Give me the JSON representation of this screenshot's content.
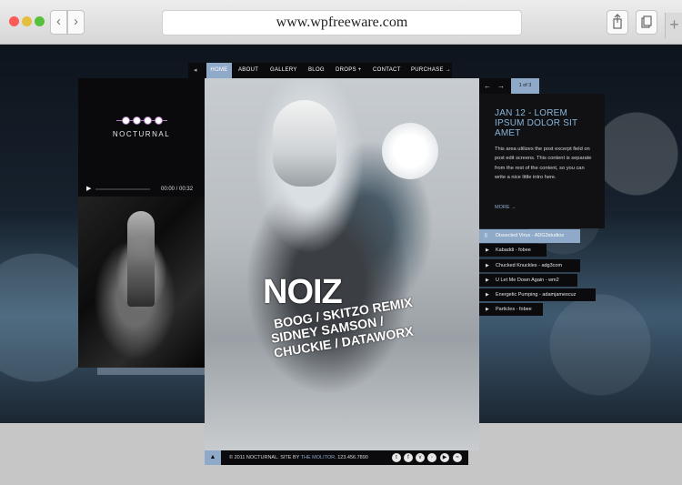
{
  "browser": {
    "url": "www.wpfreeware.com",
    "back_icon": "‹",
    "forward_icon": "›",
    "new_tab_icon": "+"
  },
  "nav": {
    "items": [
      {
        "label": "HOME"
      },
      {
        "label": "ABOUT"
      },
      {
        "label": "GALLERY"
      },
      {
        "label": "BLOG"
      },
      {
        "label": "DROPS +"
      },
      {
        "label": "CONTACT"
      },
      {
        "label": "PURCHASE →"
      }
    ]
  },
  "sidebar": {
    "logo_text": "NOCTURNAL",
    "player": {
      "time": "00:00 / 00:32",
      "progress": 0
    }
  },
  "poster": {
    "title": "NOIZ",
    "lines": [
      "BOOG / SKITZO REMIX",
      "SIDNEY SAMSON /",
      "CHUCKIE / DATAWORX"
    ]
  },
  "footer": {
    "text_before": "© 2011 NOCTURNAL. SITE BY ",
    "link": "THE MOLITOR",
    "text_after": ". 123.456.7890",
    "social_icons": [
      "t",
      "f",
      "v",
      "◦",
      "▶",
      "≈"
    ]
  },
  "post": {
    "prev_arrow": "←",
    "next_arrow": "→",
    "counter": "1 of 3",
    "title": "JAN 12 - LOREM IPSUM DOLOR SIT AMET",
    "body": "This area utilizes the post excerpt field on post edit screens. This content is separate from the rest of the content, so you can write a nice little intro here.",
    "more": "MORE →"
  },
  "playlist": {
    "header": "Dissected Virus - ADG3studios",
    "items": [
      {
        "label": "Kabaddi - fobee"
      },
      {
        "label": "Chucked Knuckles - adg3com"
      },
      {
        "label": "U Let Me Down Again - wm2"
      },
      {
        "label": "Energetic Pumping - adamjamescuz"
      },
      {
        "label": "Particles - fobee"
      }
    ]
  },
  "colors": {
    "accent": "#8fa9c9",
    "post_title": "#89b4d8",
    "panel": "#0b0b0d"
  }
}
